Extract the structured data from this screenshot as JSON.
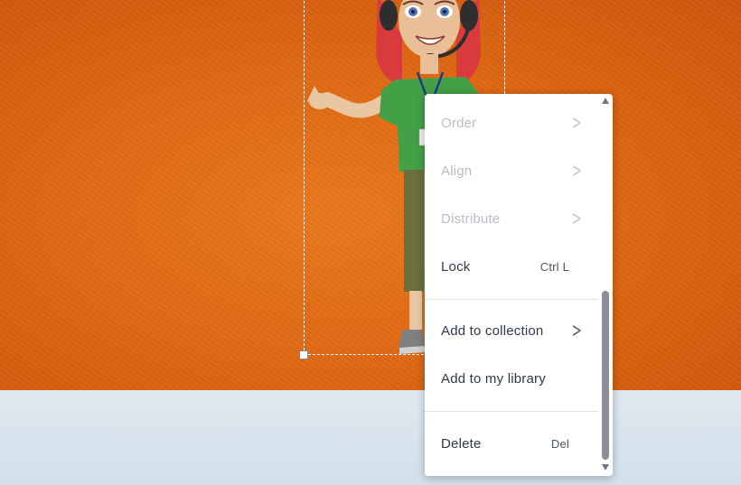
{
  "context_menu": {
    "items": [
      {
        "label": "Order",
        "enabled": false,
        "submenu": true
      },
      {
        "label": "Align",
        "enabled": false,
        "submenu": true
      },
      {
        "label": "Distribute",
        "enabled": false,
        "submenu": true
      },
      {
        "label": "Lock",
        "shortcut": "Ctrl L",
        "enabled": true
      },
      {
        "label": "Add to collection",
        "enabled": true,
        "submenu": true
      },
      {
        "label": "Add to my library",
        "enabled": true
      },
      {
        "label": "Delete",
        "shortcut": "Del",
        "enabled": true
      }
    ]
  },
  "colors": {
    "stage_background": "#e06a14",
    "bottom_area": "#d3e1ec",
    "menu_background": "#ffffff",
    "menu_text": "#2f3a46",
    "menu_text_disabled": "#b9bec4"
  },
  "icons": {
    "submenu": "chevron-right-icon",
    "scroll_up": "arrow-up-icon",
    "scroll_down": "arrow-down-icon"
  }
}
